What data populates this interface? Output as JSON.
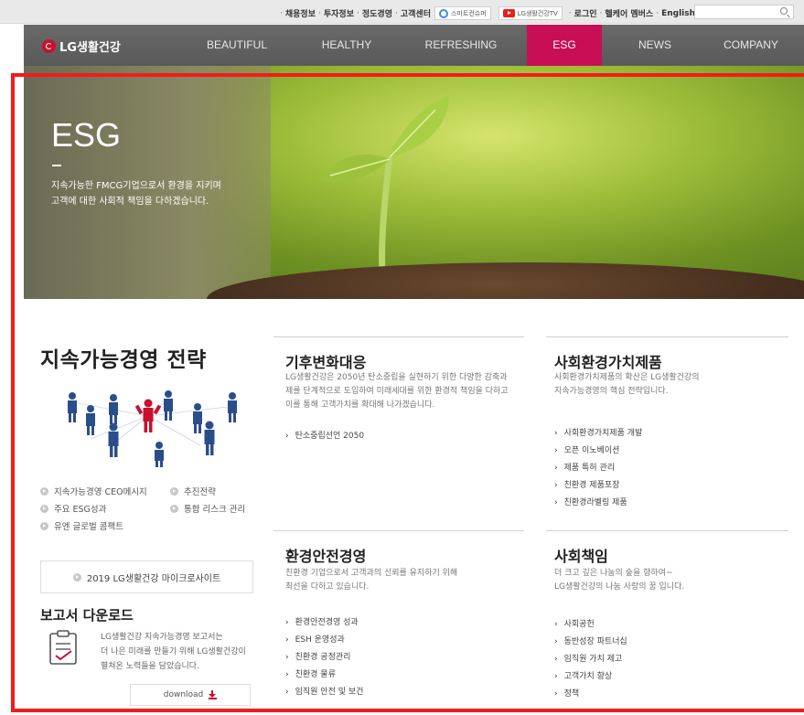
{
  "utility": {
    "links": [
      "채용정보",
      "투자정보",
      "정도경영",
      "고객센터"
    ],
    "badge_smart": "스마트컨슈머",
    "badge_tv": "LG생활건강TV",
    "links2": [
      "로그인",
      "헬케어 멤버스",
      "English"
    ],
    "search_placeholder": ""
  },
  "nav": {
    "logo_text": "LG생활건강",
    "items": [
      "BEAUTIFUL",
      "HEALTHY",
      "REFRESHING",
      "ESG",
      "NEWS",
      "COMPANY"
    ],
    "active": "ESG",
    "active_color": "#c80e55"
  },
  "hero": {
    "title": "ESG",
    "desc_line1": "지속가능한 FMCG기업으로서 환경을 지키며",
    "desc_line2": "고객에 대한 사회적 책임을 다하겠습니다."
  },
  "left": {
    "title": "지속가능경영 전략",
    "links": [
      "지속가능경영 CEO메시지",
      "추진전략",
      "주요 ESG성과",
      "통합 리스크 관리",
      "유엔 글로벌 콤팩트"
    ],
    "micro_site": "2019 LG생활건강 마이크로사이트",
    "report_title": "보고서 다운로드",
    "report_desc": [
      "LG생활건강 지속가능경영 보고서는",
      "더 나은 미래를 만들기 위해 LG생활건강이",
      "펼쳐온 노력들을 담았습니다."
    ],
    "download_label": "download"
  },
  "sections": {
    "climate": {
      "title": "기후변화대응",
      "desc": [
        "LG생활건강은 2050년 탄소중립을 실현하기 위한 다양한 감축과",
        "제를 단계적으로 도입하여 미래세대를 위한 환경적 책임을 다하고",
        "이를 통해 고객가치를 확대해 나가겠습니다."
      ],
      "items": [
        "탄소중립선언 2050"
      ]
    },
    "social_value": {
      "title": "사회환경가치제품",
      "desc": [
        "사회환경가치제품의 확산은 LG생활건강의",
        "지속가능경영의 핵심 전략입니다."
      ],
      "items": [
        "사회환경가치제품 개발",
        "오픈 이노베이션",
        "제품 특허 관리",
        "친환경 제품포장",
        "친환경라벨링 제품"
      ]
    },
    "safety": {
      "title": "환경안전경영",
      "desc": [
        "친환경 기업으로서 고객과의 신뢰를 유지하기 위해",
        "최선을 다하고 있습니다."
      ],
      "items": [
        "환경안전경영 성과",
        "ESH 운영성과",
        "친환경 공정관리",
        "친환경 물류",
        "임직원 안전 및 보건"
      ]
    },
    "responsibility": {
      "title": "사회책임",
      "desc": [
        "더 크고 깊은 나눔의 숲을 향하여~",
        "LG생활건강의 나눔 사랑의 꿈 입니다."
      ],
      "items": [
        "사회공헌",
        "동반성장 파트너십",
        "임직원 가치 제고",
        "고객가치 향상",
        "정책"
      ]
    }
  }
}
